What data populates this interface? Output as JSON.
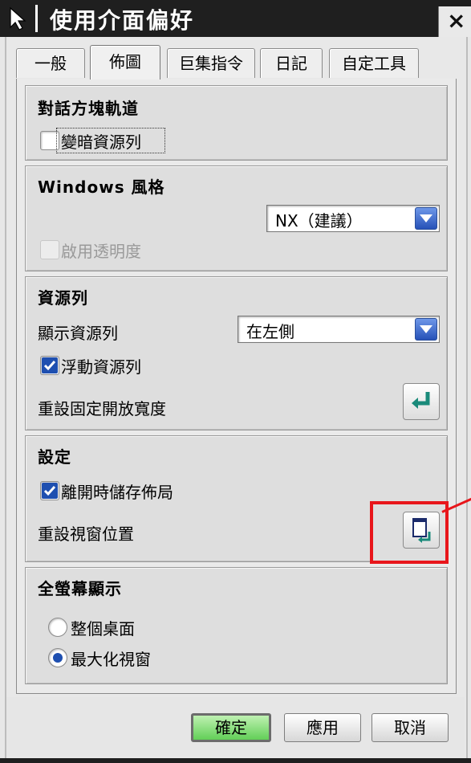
{
  "window": {
    "title": "使用介面偏好",
    "close_label": "×"
  },
  "tabs": [
    {
      "label": "一般",
      "active": false
    },
    {
      "label": "佈圖",
      "active": true
    },
    {
      "label": "巨集指令",
      "active": false
    },
    {
      "label": "日記",
      "active": false
    },
    {
      "label": "自定工具",
      "active": false
    }
  ],
  "groups": {
    "dialog_rail": {
      "title": "對話方塊軌道",
      "dim_resource_bar": {
        "label": "變暗資源列",
        "checked": false
      }
    },
    "windows_style": {
      "title": "Windows 風格",
      "style_select": {
        "value": "NX（建議）"
      },
      "enable_transparency": {
        "label": "啟用透明度",
        "checked": false,
        "disabled": true
      }
    },
    "resource_bar": {
      "title": "資源列",
      "display_label": "顯示資源列",
      "display_select": {
        "value": "在左側"
      },
      "floating": {
        "label": "浮動資源列",
        "checked": true
      },
      "reset_width_label": "重設固定開放寬度"
    },
    "settings": {
      "title": "設定",
      "save_layout": {
        "label": "離開時儲存佈局",
        "checked": true
      },
      "reset_position_label": "重設視窗位置"
    },
    "fullscreen": {
      "title": "全螢幕顯示",
      "options": [
        {
          "label": "整個桌面",
          "selected": false
        },
        {
          "label": "最大化視窗",
          "selected": true
        }
      ]
    }
  },
  "buttons": {
    "ok": "確定",
    "apply": "應用",
    "cancel": "取消"
  },
  "colors": {
    "accent_blue": "#1e4fb0",
    "highlight_red": "#e8161b",
    "ok_green": "#62cf57"
  }
}
